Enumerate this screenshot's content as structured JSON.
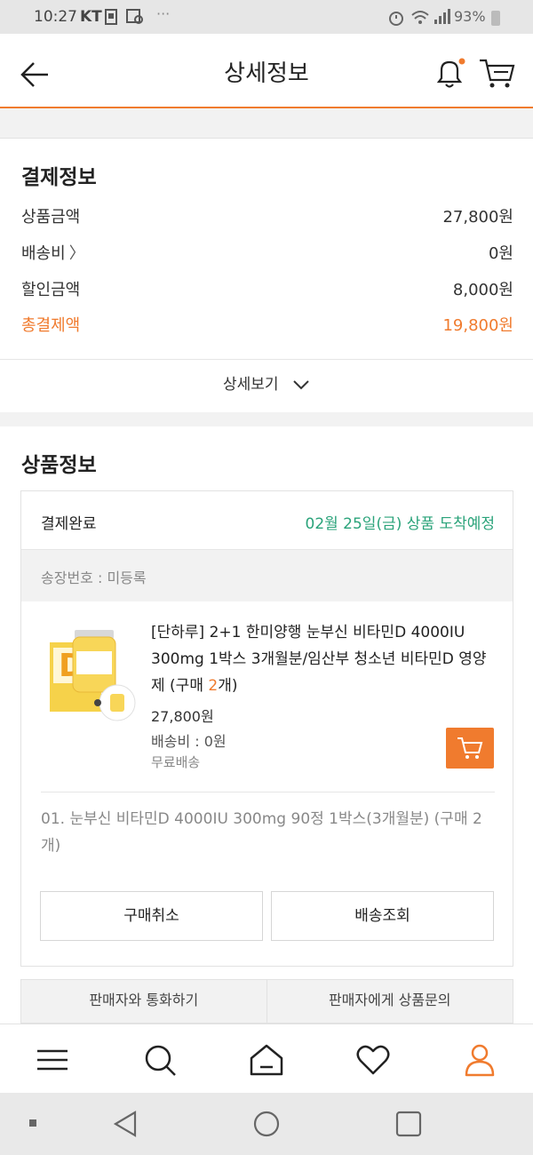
{
  "status_bar": {
    "time": "10:27",
    "carrier": "KT",
    "battery": "93%"
  },
  "header": {
    "title": "상세정보"
  },
  "payment": {
    "title": "결제정보",
    "rows": [
      {
        "label": "상품금액",
        "value": "27,800원"
      },
      {
        "label": "배송비",
        "value": "0원"
      },
      {
        "label": "할인금액",
        "value": "8,000원"
      },
      {
        "label": "총결제액",
        "value": "19,800원"
      }
    ],
    "detail_label": "상세보기",
    "chevron_right": "〉"
  },
  "product": {
    "title": "상품정보",
    "status": "결제완료",
    "arrival": "02월 25일(금) 상품 도착예정",
    "invoice": "송장번호 : 미등록",
    "name_prefix": "[단하루] 2+1 한미양행 눈부신 비타민D 4000IU 300mg 1박스 3개월분/임산부 청소년 비타민D 영양제 (구매 ",
    "name_qty": "2",
    "name_suffix": "개)",
    "price": "27,800원",
    "shipping": "배송비 : 0원",
    "shipping_note": "무료배송",
    "option": "01. 눈부신 비타민D 4000IU 300mg 90정 1박스(3개월분) (구매 2개)",
    "cancel_button": "구매취소",
    "track_button": "배송조회",
    "seller_call": "판매자와 통화하기",
    "seller_inquiry": "판매자에게 상품문의"
  },
  "colors": {
    "accent": "#f07b2e",
    "arrival_green": "#2aa37a"
  },
  "icons": {
    "header": [
      "back-arrow-icon",
      "bell-icon",
      "cart-icon"
    ],
    "bottom_nav": [
      "menu-icon",
      "search-icon",
      "home-icon",
      "heart-icon",
      "profile-icon"
    ],
    "system_nav": [
      "back-triangle-icon",
      "home-circle-icon",
      "recents-square-icon"
    ]
  }
}
